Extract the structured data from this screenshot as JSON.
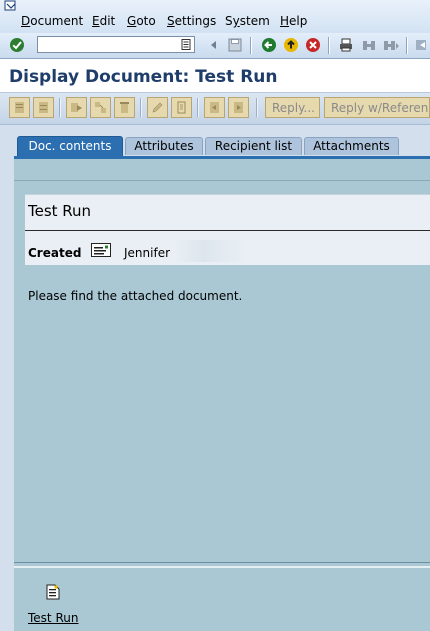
{
  "menu": {
    "items": [
      {
        "label": "Document",
        "accel": "D"
      },
      {
        "label": "Edit",
        "accel": "E"
      },
      {
        "label": "Goto",
        "accel": "G"
      },
      {
        "label": "Settings",
        "accel": "S"
      },
      {
        "label": "System",
        "accel": "y"
      },
      {
        "label": "Help",
        "accel": "H"
      }
    ]
  },
  "okcode": {
    "value": ""
  },
  "title": "Display Document: Test Run",
  "app_toolbar": {
    "reply_label": "Reply...",
    "reply_ref_label": "Reply w/Reference"
  },
  "tabs": [
    {
      "label": "Doc. contents",
      "active": true
    },
    {
      "label": "Attributes",
      "active": false
    },
    {
      "label": "Recipient list",
      "active": false
    },
    {
      "label": "Attachments",
      "active": false
    }
  ],
  "document": {
    "title": "Test Run",
    "created_label": "Created",
    "created_by": "Jennifer",
    "body": "Please find the attached document."
  },
  "attachment": {
    "label": "Test Run"
  },
  "colors": {
    "title": "#1f3d6b",
    "active_tab": "#2c6fb0",
    "tab_body": "#a9c8d4"
  }
}
